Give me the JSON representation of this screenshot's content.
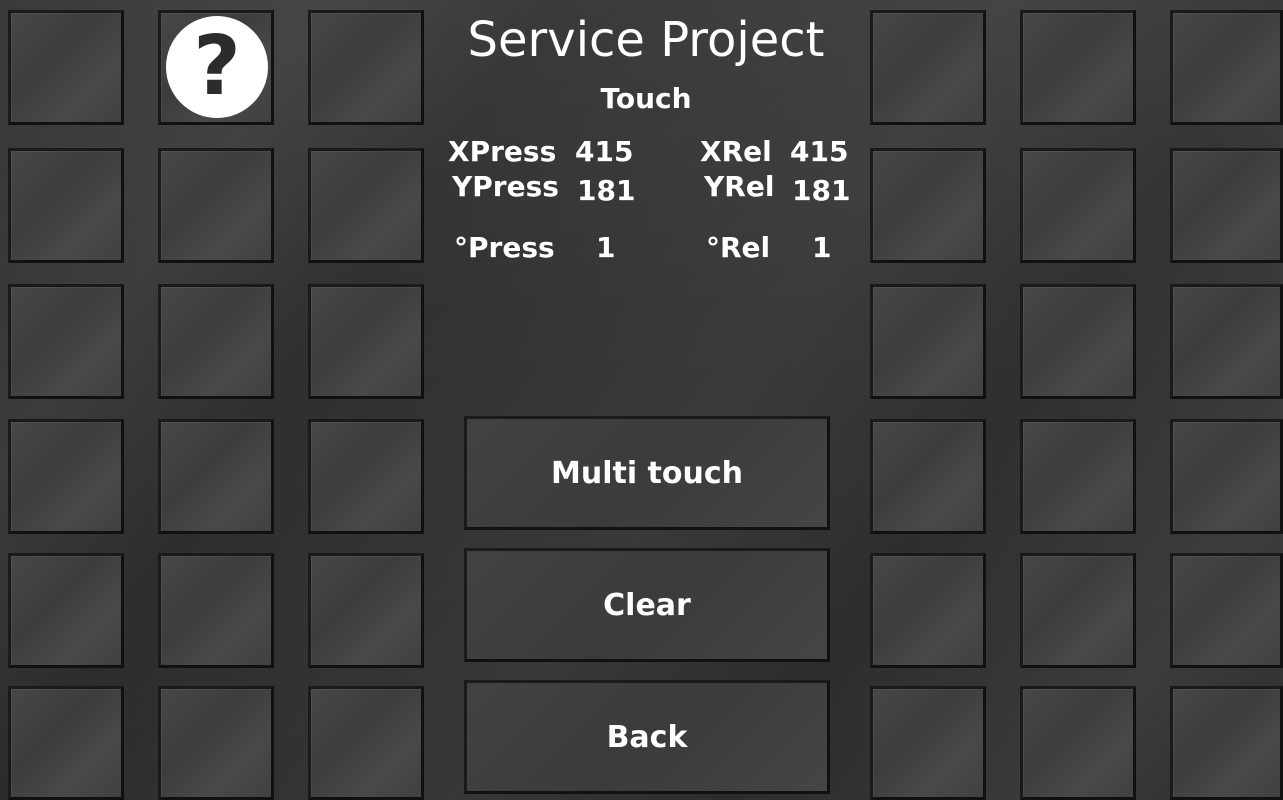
{
  "header": {
    "title": "Service Project",
    "subtitle": "Touch",
    "help_glyph": "?",
    "help_icon": "question-mark-icon"
  },
  "touch_readout": {
    "xpress_label": "XPress",
    "xpress_value": "415",
    "ypress_label": "YPress",
    "ypress_value": "181",
    "press_count_label": "°Press",
    "press_count_value": "1",
    "xrel_label": "XRel",
    "xrel_value": "415",
    "yrel_label": "YRel",
    "yrel_value": "181",
    "rel_count_label": "°Rel",
    "rel_count_value": "1"
  },
  "buttons": {
    "multi_touch": "Multi touch",
    "clear": "Clear",
    "back": "Back"
  },
  "colors": {
    "background": "#2c2c2c",
    "tile": "#3d3d3d",
    "text": "#ffffff"
  }
}
